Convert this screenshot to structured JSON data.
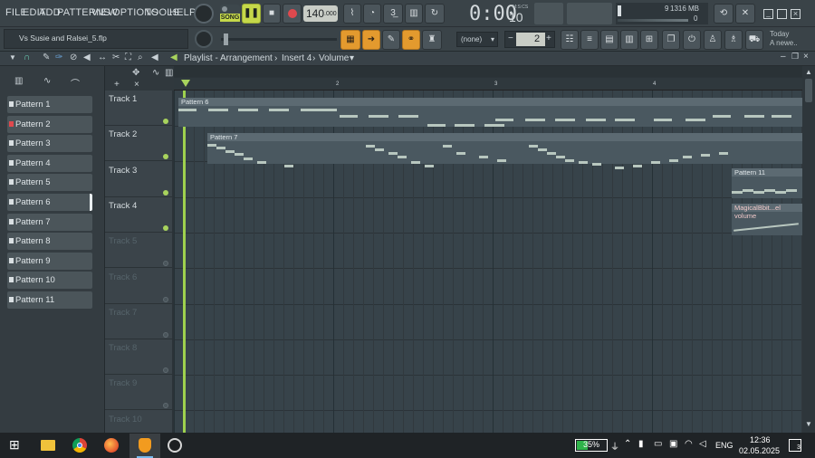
{
  "menu": [
    "FILE",
    "EDIT",
    "ADD",
    "PATTERNS",
    "VIEW",
    "OPTIONS",
    "TOOLS",
    "HELP"
  ],
  "transport": {
    "mode": "SONG",
    "tempo": "140",
    "tempo_decimal": ".000",
    "time": "0:00",
    "time_frac": "10",
    "time_unit": "M:S:CS"
  },
  "meters": {
    "cpu": "9",
    "memory": "1316 MB",
    "voices": "0"
  },
  "project": {
    "file": "Vs Susie and Ralsei_5.flp"
  },
  "toolbar2": {
    "dropdown": "(none)",
    "step": "2"
  },
  "news": {
    "line1": "Today",
    "line2": "A newe.."
  },
  "playlist": {
    "title": "Playlist - Arrangement",
    "sep1": "›",
    "insert": "Insert 4",
    "sep2": "›",
    "param": "Volume"
  },
  "ruler_labels": [
    "2",
    "3",
    "4"
  ],
  "patterns": [
    "Pattern 1",
    "Pattern 2",
    "Pattern 3",
    "Pattern 4",
    "Pattern 5",
    "Pattern 6",
    "Pattern 7",
    "Pattern 8",
    "Pattern 9",
    "Pattern 10",
    "Pattern 11"
  ],
  "tracks": [
    "Track 1",
    "Track 2",
    "Track 3",
    "Track 4",
    "Track 5",
    "Track 6",
    "Track 7",
    "Track 8",
    "Track 9",
    "Track 10"
  ],
  "clips": {
    "c1": "Pattern 6",
    "c2": "Pattern 7",
    "c3": "Pattern 11",
    "c4": "MagicalBbit...el volume"
  },
  "taskbar": {
    "battery": "35%",
    "lang": "ENG",
    "time": "12:36",
    "date": "02.05.2025",
    "notif": "3"
  },
  "colors": {
    "accent_orange": "#e39a2e",
    "accent_green": "#a8d35d",
    "song_yellow": "#c5d84a"
  }
}
